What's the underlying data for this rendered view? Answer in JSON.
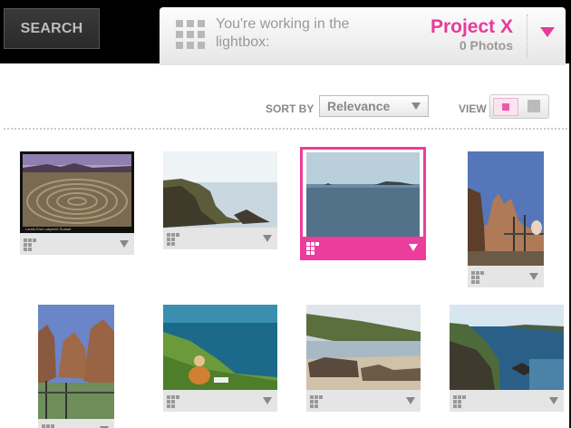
{
  "header": {
    "search_label": "SEARCH",
    "lightbox_text": "You're working in the lightbox:",
    "project_name": "Project X",
    "photo_count": "0 Photos"
  },
  "toolbar": {
    "sort_by_label": "SORT BY",
    "sort_value": "Relevance",
    "view_label": "VIEW"
  },
  "colors": {
    "accent": "#e83a9a",
    "selected_outline": "#ec3c9c"
  },
  "photos": [
    {
      "subject": "labyrinth",
      "selected": false,
      "caption": "Lands End Labyrinth Sunset"
    },
    {
      "subject": "coast-rocks",
      "selected": false
    },
    {
      "subject": "sea-horizon",
      "selected": true
    },
    {
      "subject": "cliff-people",
      "selected": false
    },
    {
      "subject": "rock-pillars",
      "selected": false
    },
    {
      "subject": "person-sitting-coast",
      "selected": false
    },
    {
      "subject": "shipwreck-beach",
      "selected": false
    },
    {
      "subject": "rocky-inlet",
      "selected": false
    }
  ]
}
